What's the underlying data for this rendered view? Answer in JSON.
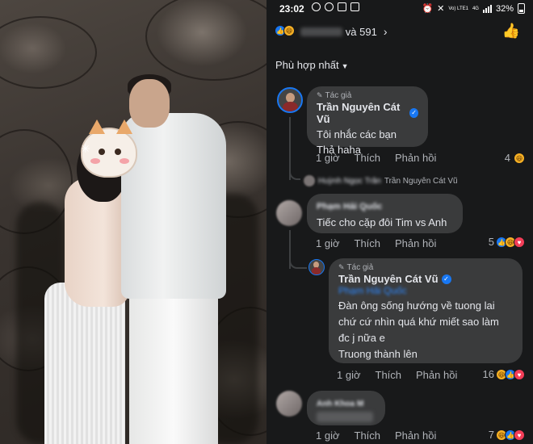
{
  "status_bar": {
    "time": "23:02",
    "network": "Vo) LTE1",
    "network_type": "4G",
    "battery": "32%"
  },
  "reactions": {
    "others_count": "và 591",
    "like_icon": "like-icon",
    "haha_icon": "haha-icon"
  },
  "sort": {
    "label": "Phù hợp nhất"
  },
  "comments": [
    {
      "author_tag": "Tác giả",
      "name": "Trần Nguyên Cát Vũ",
      "lines": [
        "Tôi nhắc các bạn",
        "Thả haha"
      ],
      "time": "1 giờ",
      "like": "Thích",
      "reply": "Phản hồi",
      "reaction_count": "4",
      "reply_preview_name": "Trần Nguyên Cát Vũ"
    },
    {
      "lines": [
        "Tiếc cho cặp đôi Tim vs Anh"
      ],
      "time": "1 giờ",
      "like": "Thích",
      "reply": "Phản hồi",
      "reaction_count": "5"
    },
    {
      "author_tag": "Tác giả",
      "name": "Trần Nguyên Cát Vũ",
      "lines": [
        "Đàn ông sống hướng về tuong lai",
        "chứ cứ nhìn quá khứ miết sao làm",
        "đc j nữa e",
        "Truong thành lên"
      ],
      "time": "1 giờ",
      "like": "Thích",
      "reply": "Phản hồi",
      "reaction_count": "16"
    },
    {
      "time": "1 giờ",
      "like": "Thích",
      "reply": "Phản hồi",
      "reaction_count": "7"
    }
  ]
}
